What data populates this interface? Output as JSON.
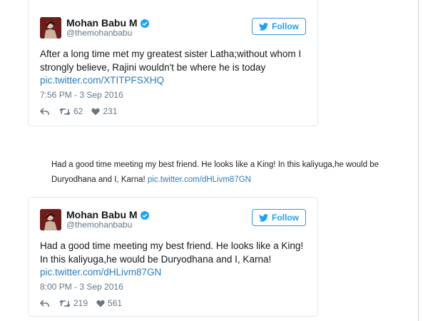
{
  "tweets": [
    {
      "author_name": "Mohan Babu M",
      "handle": "@themohanbabu",
      "follow_label": "Follow",
      "text": "After a long time met my greatest sister Latha;without whom I strongly believe, Rajini wouldn't be where he is today ",
      "link": "pic.twitter.com/XTITPFSXHQ",
      "timestamp": "7:56 PM - 3 Sep 2016",
      "retweets": "62",
      "likes": "231"
    },
    {
      "author_name": "Mohan Babu M",
      "handle": "@themohanbabu",
      "follow_label": "Follow",
      "text": "Had a good time meeting my best friend. He looks like a King! In this kaliyuga,he would be Duryodhana and I, Karna! ",
      "link": "pic.twitter.com/dHLivm87GN",
      "timestamp": "8:00 PM - 3 Sep 2016",
      "retweets": "219",
      "likes": "561"
    }
  ],
  "caption": {
    "text": "Had a good time meeting my best friend. He looks like a King! In this kaliyuga,he would be Duryodhana and I, Karna! ",
    "link": "pic.twitter.com/dHLivm87GN"
  },
  "icons": {
    "verified": "verified-badge-icon",
    "follow": "twitter-bird-icon",
    "reply": "reply-arrow-icon",
    "retweet": "retweet-icon",
    "like": "heart-icon"
  },
  "colors": {
    "link": "#2b7bb9",
    "follow_button": "#1da1f2",
    "verified": "#1da1f2",
    "muted_text": "#657786",
    "card_border": "#e1e8ed"
  }
}
